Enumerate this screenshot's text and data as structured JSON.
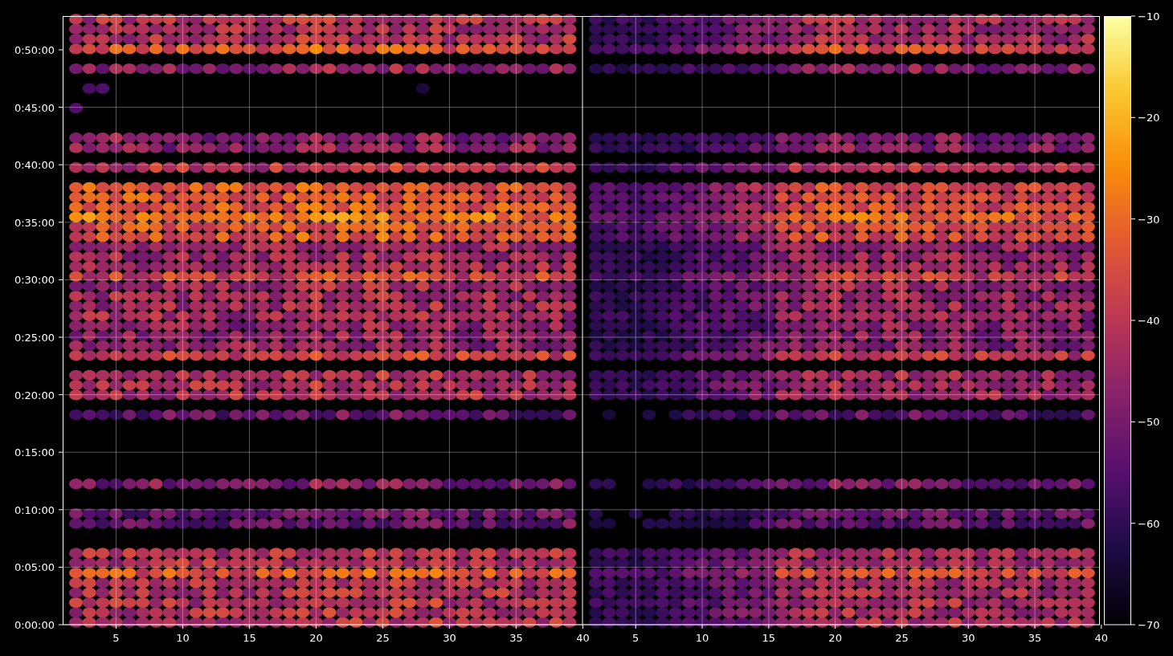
{
  "y_ticks": [
    "0:50:00",
    "0:45:00",
    "0:40:00",
    "0:35:00",
    "0:30:00",
    "0:25:00",
    "0:20:00",
    "0:15:00",
    "0:10:00",
    "0:05:00",
    "0:00:00"
  ],
  "left_panel": {
    "x_ticks": [
      "5",
      "10",
      "15",
      "20",
      "25",
      "30",
      "35",
      "40"
    ]
  },
  "right_panel": {
    "x_ticks": [
      "5",
      "10",
      "15",
      "20",
      "25",
      "30",
      "35",
      "40"
    ]
  },
  "colorbar": {
    "ticks": [
      "−10",
      "−20",
      "−30",
      "−40",
      "−50",
      "−60",
      "−70"
    ]
  }
}
